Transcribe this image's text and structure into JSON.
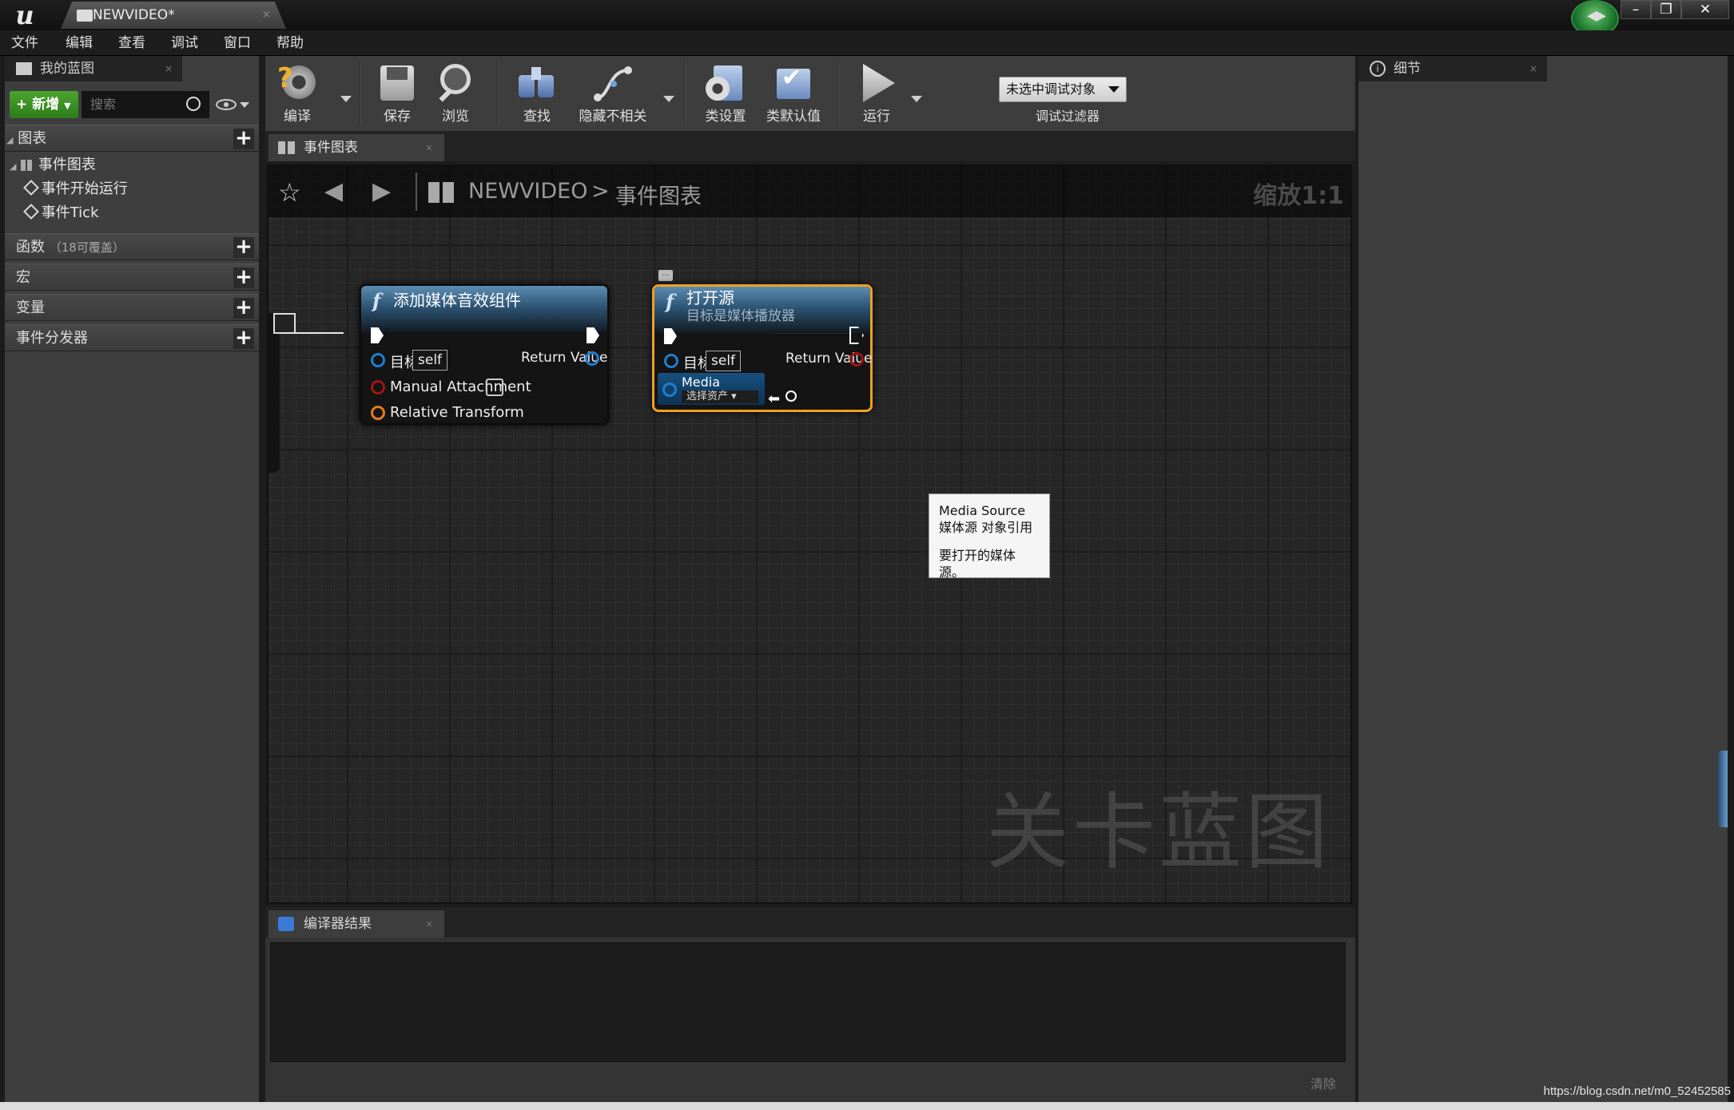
{
  "window": {
    "tab_title": "NEWVIDEO*",
    "tab_close": "×",
    "minimize": "–",
    "restore": "❐",
    "close": "✕"
  },
  "menu": [
    "文件",
    "编辑",
    "查看",
    "调试",
    "窗口",
    "帮助"
  ],
  "my_blueprint": {
    "tab_label": "我的蓝图",
    "tab_close": "×",
    "new_button": "新增",
    "search_placeholder": "搜索",
    "sections": {
      "graphs": "图表",
      "event_graph": "事件图表",
      "event_begin": "事件开始运行",
      "event_tick": "事件Tick",
      "functions": "函数",
      "functions_note": "（18可覆盖）",
      "macros": "宏",
      "variables": "变量",
      "dispatchers": "事件分发器"
    }
  },
  "toolbar": {
    "compile": "编译",
    "save": "保存",
    "browse": "浏览",
    "find": "查找",
    "hide_unrelated": "隐藏不相关",
    "class_settings": "类设置",
    "class_defaults": "类默认值",
    "run": "运行",
    "debug_object": "未选中调试对象",
    "debug_filter": "调试过滤器"
  },
  "graph_tab": {
    "label": "事件图表",
    "close": "×"
  },
  "graph": {
    "breadcrumb_root": "NEWVIDEO",
    "breadcrumb_sep": ">",
    "breadcrumb_current": "事件图表",
    "zoom": "缩放1:1",
    "watermark": "关卡蓝图"
  },
  "node_add_audio": {
    "title": "添加媒体音效组件",
    "target_label": "目标",
    "target_value": "self",
    "return_value": "Return Value",
    "manual_attachment": "Manual Attachment",
    "relative_transform": "Relative Transform"
  },
  "node_open_source": {
    "title": "打开源",
    "subtitle": "目标是媒体播放器",
    "target_label": "目标",
    "target_value": "self",
    "return_value": "Return Value",
    "media_source": "Media Source",
    "select_asset": "选择资产"
  },
  "tooltip": {
    "line1": "Media Source",
    "line2": "媒体源 对象引用",
    "line3": "要打开的媒体源。"
  },
  "compiler": {
    "tab_label": "编译器结果",
    "tab_close": "×",
    "clear": "清除"
  },
  "details": {
    "tab_label": "细节",
    "tab_close": "×"
  },
  "footer_url": "https://blog.csdn.net/m0_52452585",
  "colors": {
    "accent_green": "#3f9b27",
    "selection_orange": "#f0a020",
    "pin_blue": "#1e7ed3",
    "pin_red": "#a11414",
    "pin_orange": "#e87a20"
  }
}
